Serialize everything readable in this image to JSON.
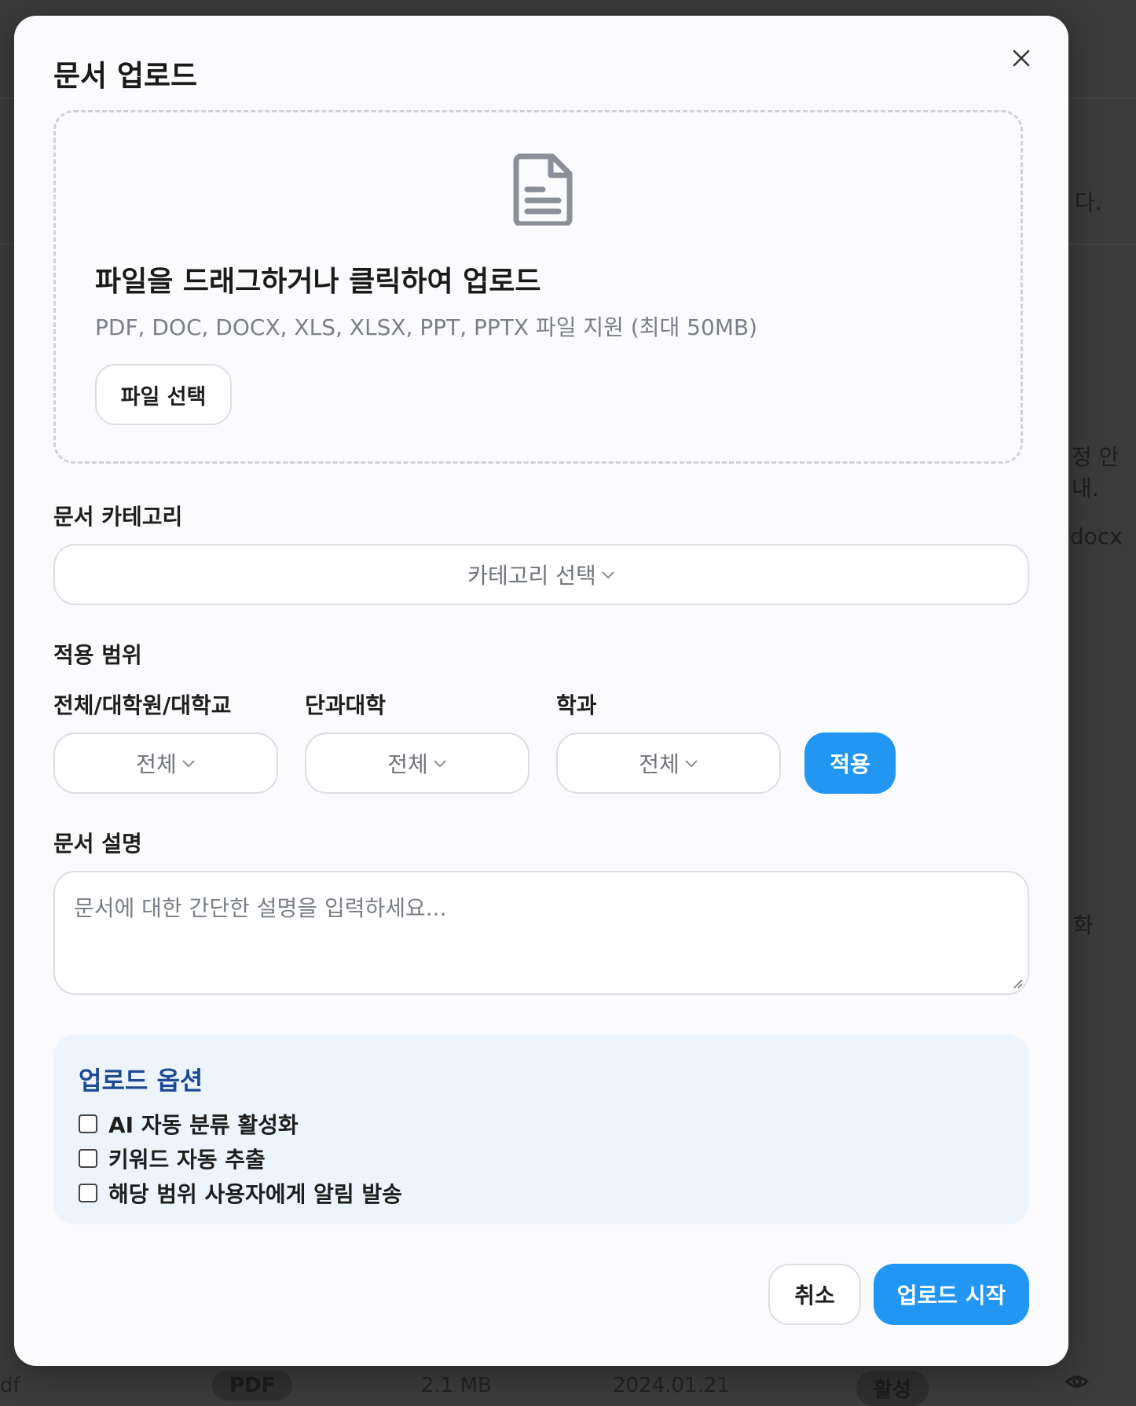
{
  "background": {
    "fragments": [
      "다.",
      "정 안내.",
      "docx",
      "화",
      "df"
    ],
    "bottom_row": {
      "type_badge": "PDF",
      "size": "2.1 MB",
      "date": "2024.01.21",
      "status": "활성"
    }
  },
  "modal": {
    "title": "문서 업로드",
    "close_icon": "close-icon",
    "dropzone": {
      "icon": "document-icon",
      "heading": "파일을 드래그하거나 클릭하여 업로드",
      "subtext": "PDF, DOC, DOCX, XLS, XLSX, PPT, PPTX 파일 지원 (최대 50MB)",
      "button_label": "파일 선택"
    },
    "category": {
      "label": "문서 카테고리",
      "value": "카테고리 선택"
    },
    "scope": {
      "label": "적용 범위",
      "filters": [
        {
          "label": "전체/대학원/대학교",
          "value": "전체"
        },
        {
          "label": "단과대학",
          "value": "전체"
        },
        {
          "label": "학과",
          "value": "전체"
        }
      ],
      "apply_label": "적용"
    },
    "description": {
      "label": "문서 설명",
      "placeholder": "문서에 대한 간단한 설명을 입력하세요..."
    },
    "options": {
      "title": "업로드 옵션",
      "items": [
        {
          "label": "AI 자동 분류 활성화",
          "checked": false
        },
        {
          "label": "키워드 자동 추출",
          "checked": false
        },
        {
          "label": "해당 범위 사용자에게 알림 발송",
          "checked": false
        }
      ]
    },
    "footer": {
      "cancel_label": "취소",
      "submit_label": "업로드 시작"
    }
  },
  "colors": {
    "accent": "#2196f3",
    "options_bg": "#eef4fc",
    "options_title": "#1d4a94"
  }
}
